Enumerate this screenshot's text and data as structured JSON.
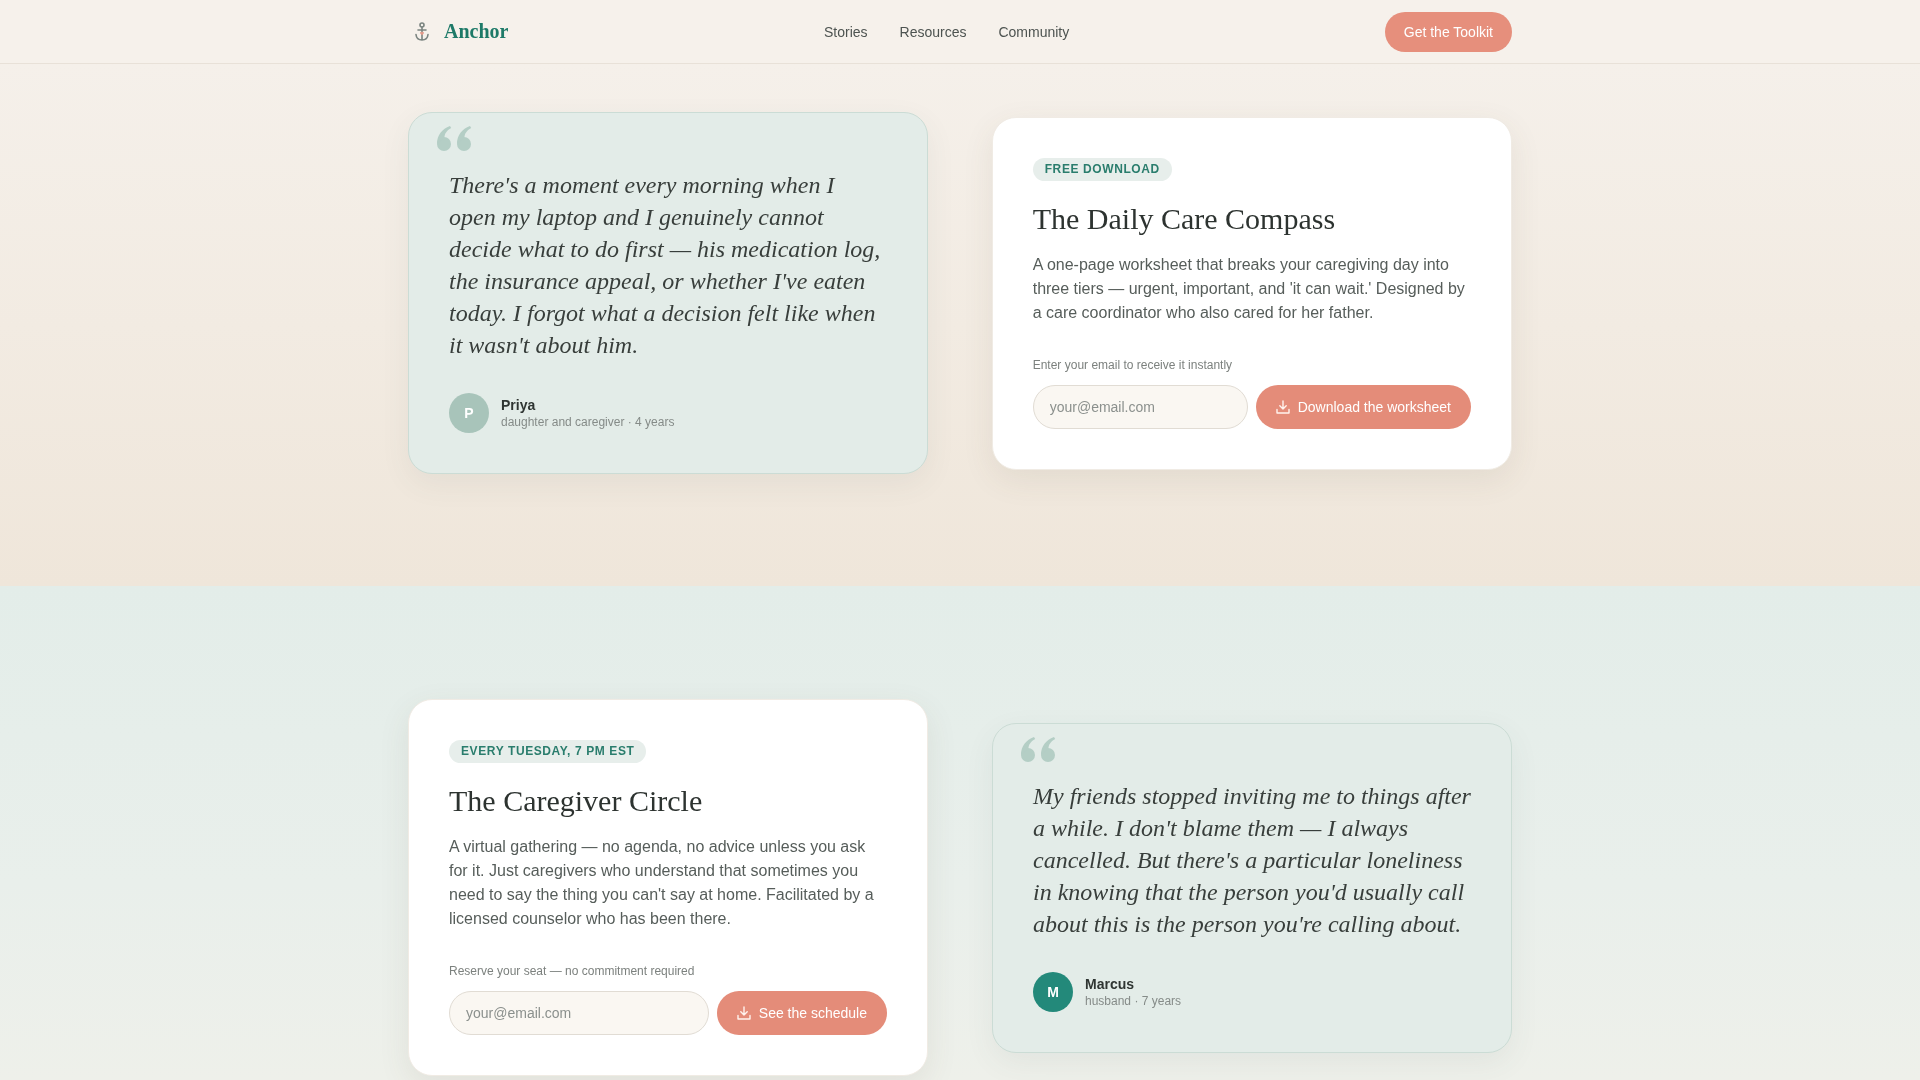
{
  "nav": {
    "brand": "Anchor",
    "links": [
      "Stories",
      "Resources",
      "Community"
    ],
    "cta": "Get the Toolkit"
  },
  "sections": [
    {
      "cards": [
        {
          "kind": "quote",
          "quote": "There's a moment every morning when I open my laptop and I genuinely cannot decide what to do first — his medication log, the insurance appeal, or whether I've eaten today. I forgot what a decision felt like when it wasn't about him.",
          "author": {
            "initial": "P",
            "name": "Priya",
            "role": "daughter and caregiver · 4 years",
            "color": "#a8c4ba"
          }
        },
        {
          "kind": "offer",
          "badge": "FREE DOWNLOAD",
          "title": "The Daily Care Compass",
          "description": "A one-page worksheet that breaks your caregiving day into three tiers — urgent, important, and 'it can wait.' Designed by a care coordinator who also cared for her father.",
          "field_label": "Enter your email to receive it instantly",
          "email": {
            "placeholder": "your@email.com"
          },
          "button": "Download the worksheet"
        }
      ]
    },
    {
      "cards": [
        {
          "kind": "offer",
          "badge": "EVERY TUESDAY, 7 PM EST",
          "title": "The Caregiver Circle",
          "description": "A virtual gathering — no agenda, no advice unless you ask for it. Just caregivers who understand that sometimes you need to say the thing you can't say at home. Facilitated by a licensed counselor who has been there.",
          "field_label": "Reserve your seat — no commitment required",
          "email": {
            "placeholder": "your@email.com"
          },
          "button": "See the schedule"
        },
        {
          "kind": "quote",
          "quote": "My friends stopped inviting me to things after a while. I don't blame them — I always cancelled. But there's a particular loneliness in knowing that the person you'd usually call about this is the person you're calling about.",
          "author": {
            "initial": "M",
            "name": "Marcus",
            "role": "husband · 7 years",
            "color": "#23897a"
          }
        }
      ]
    }
  ]
}
